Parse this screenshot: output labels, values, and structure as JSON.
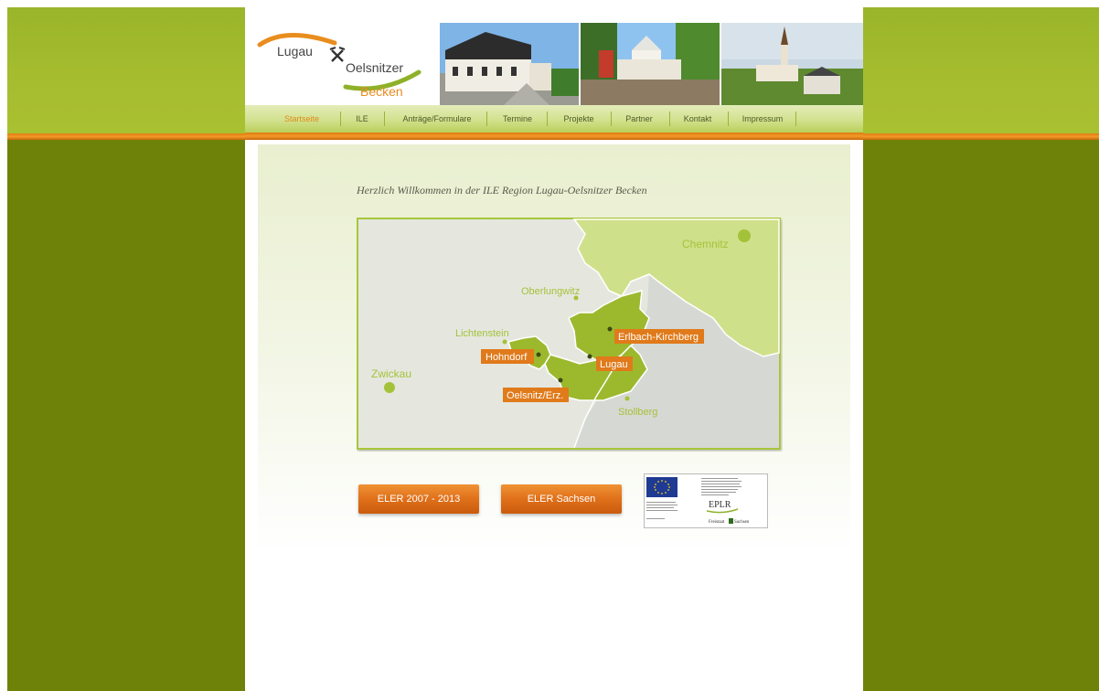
{
  "header": {
    "logo": {
      "word1": "Lugau",
      "word2": "Oelsnitzer",
      "word3": "Becken",
      "icon": "hammer-pick-icon"
    }
  },
  "nav": {
    "items": [
      {
        "label": "Startseite",
        "active": true
      },
      {
        "label": "ILE"
      },
      {
        "label": "Anträge/Formulare"
      },
      {
        "label": "Termine"
      },
      {
        "label": "Projekte"
      },
      {
        "label": "Partner"
      },
      {
        "label": "Kontakt"
      },
      {
        "label": "Impressum"
      }
    ],
    "active_color": "#e08a1a"
  },
  "content": {
    "welcome": "Herzlich Willkommen in der ILE Region Lugau-Oelsnitzer Becken"
  },
  "map": {
    "places": {
      "chemnitz": "Chemnitz",
      "oberlungwitz": "Oberlungwitz",
      "lichtenstein": "Lichtenstein",
      "zwickau": "Zwickau",
      "stollberg": "Stollberg"
    },
    "region_labels": {
      "erlbach": "Erlbach-Kirchberg",
      "hohndorf": "Hohndorf",
      "lugau": "Lugau",
      "oelsnitz": "Oelsnitz/Erz."
    },
    "colors": {
      "region": "#9cb92e",
      "neighbor": "#cfe08a",
      "label_bg": "#e07a1a"
    }
  },
  "buttons": {
    "eler_2007": "ELER 2007 - 2013",
    "eler_sachsen": "ELER Sachsen"
  },
  "eu_logo": {
    "eplr": "EPLR",
    "freistaat": "Freistaat",
    "sachsen": "Sachsen"
  },
  "colors": {
    "outer_bg": "#6e8209",
    "top_band": "#a6bd2f",
    "orange_stripe": "#e8851c"
  }
}
